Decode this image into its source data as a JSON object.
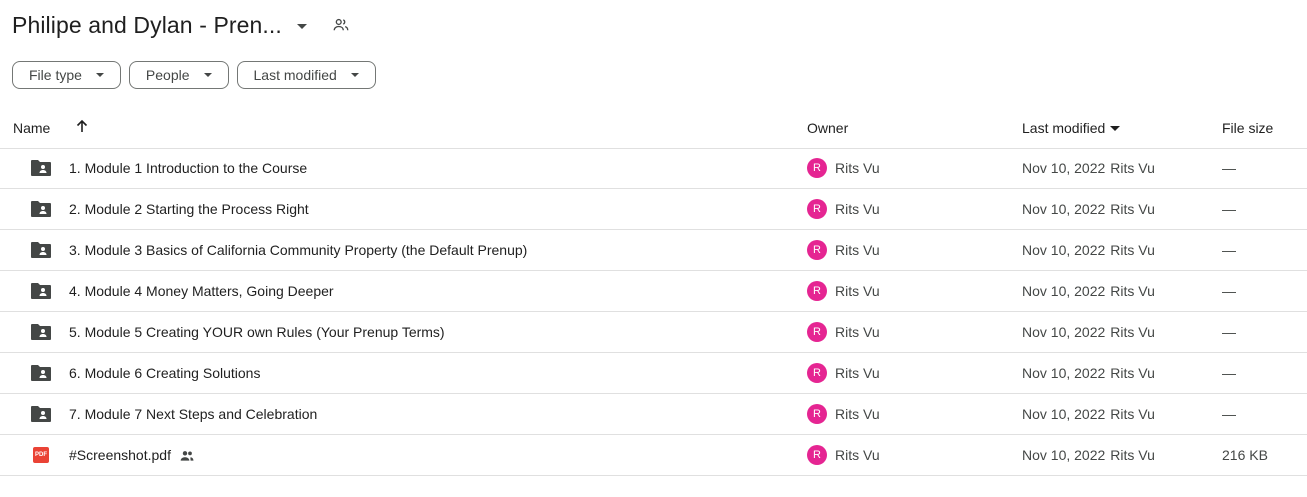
{
  "header": {
    "title": "Philipe and Dylan - Pren...",
    "icon": "people-shared-icon"
  },
  "filters": [
    {
      "label": "File type"
    },
    {
      "label": "People"
    },
    {
      "label": "Last modified"
    }
  ],
  "columns": {
    "name": "Name",
    "owner": "Owner",
    "modified": "Last modified",
    "size": "File size"
  },
  "files": [
    {
      "name": "1. Module 1 Introduction to the Course",
      "type": "shared-folder",
      "owner_initial": "R",
      "owner": "Rits Vu",
      "date": "Nov 10, 2022",
      "by": "Rits Vu",
      "size": "—"
    },
    {
      "name": "2. Module 2 Starting the Process Right",
      "type": "shared-folder",
      "owner_initial": "R",
      "owner": "Rits Vu",
      "date": "Nov 10, 2022",
      "by": "Rits Vu",
      "size": "—"
    },
    {
      "name": "3. Module 3 Basics of California Community Property (the Default Prenup)",
      "type": "shared-folder",
      "owner_initial": "R",
      "owner": "Rits Vu",
      "date": "Nov 10, 2022",
      "by": "Rits Vu",
      "size": "—"
    },
    {
      "name": "4. Module 4 Money Matters, Going Deeper",
      "type": "shared-folder",
      "owner_initial": "R",
      "owner": "Rits Vu",
      "date": "Nov 10, 2022",
      "by": "Rits Vu",
      "size": "—"
    },
    {
      "name": "5. Module 5 Creating YOUR own Rules (Your Prenup Terms)",
      "type": "shared-folder",
      "owner_initial": "R",
      "owner": "Rits Vu",
      "date": "Nov 10, 2022",
      "by": "Rits Vu",
      "size": "—"
    },
    {
      "name": "6. Module 6 Creating Solutions",
      "type": "shared-folder",
      "owner_initial": "R",
      "owner": "Rits Vu",
      "date": "Nov 10, 2022",
      "by": "Rits Vu",
      "size": "—"
    },
    {
      "name": "7. Module 7 Next Steps and Celebration",
      "type": "shared-folder",
      "owner_initial": "R",
      "owner": "Rits Vu",
      "date": "Nov 10, 2022",
      "by": "Rits Vu",
      "size": "—"
    },
    {
      "name": "#Screenshot.pdf",
      "type": "pdf",
      "pdf_label": "PDF",
      "owner_initial": "R",
      "owner": "Rits Vu",
      "date": "Nov 10, 2022",
      "by": "Rits Vu",
      "size": "216 KB"
    }
  ],
  "colors": {
    "avatar": "#e52592",
    "pdf": "#ea4335",
    "folder": "#444746"
  }
}
